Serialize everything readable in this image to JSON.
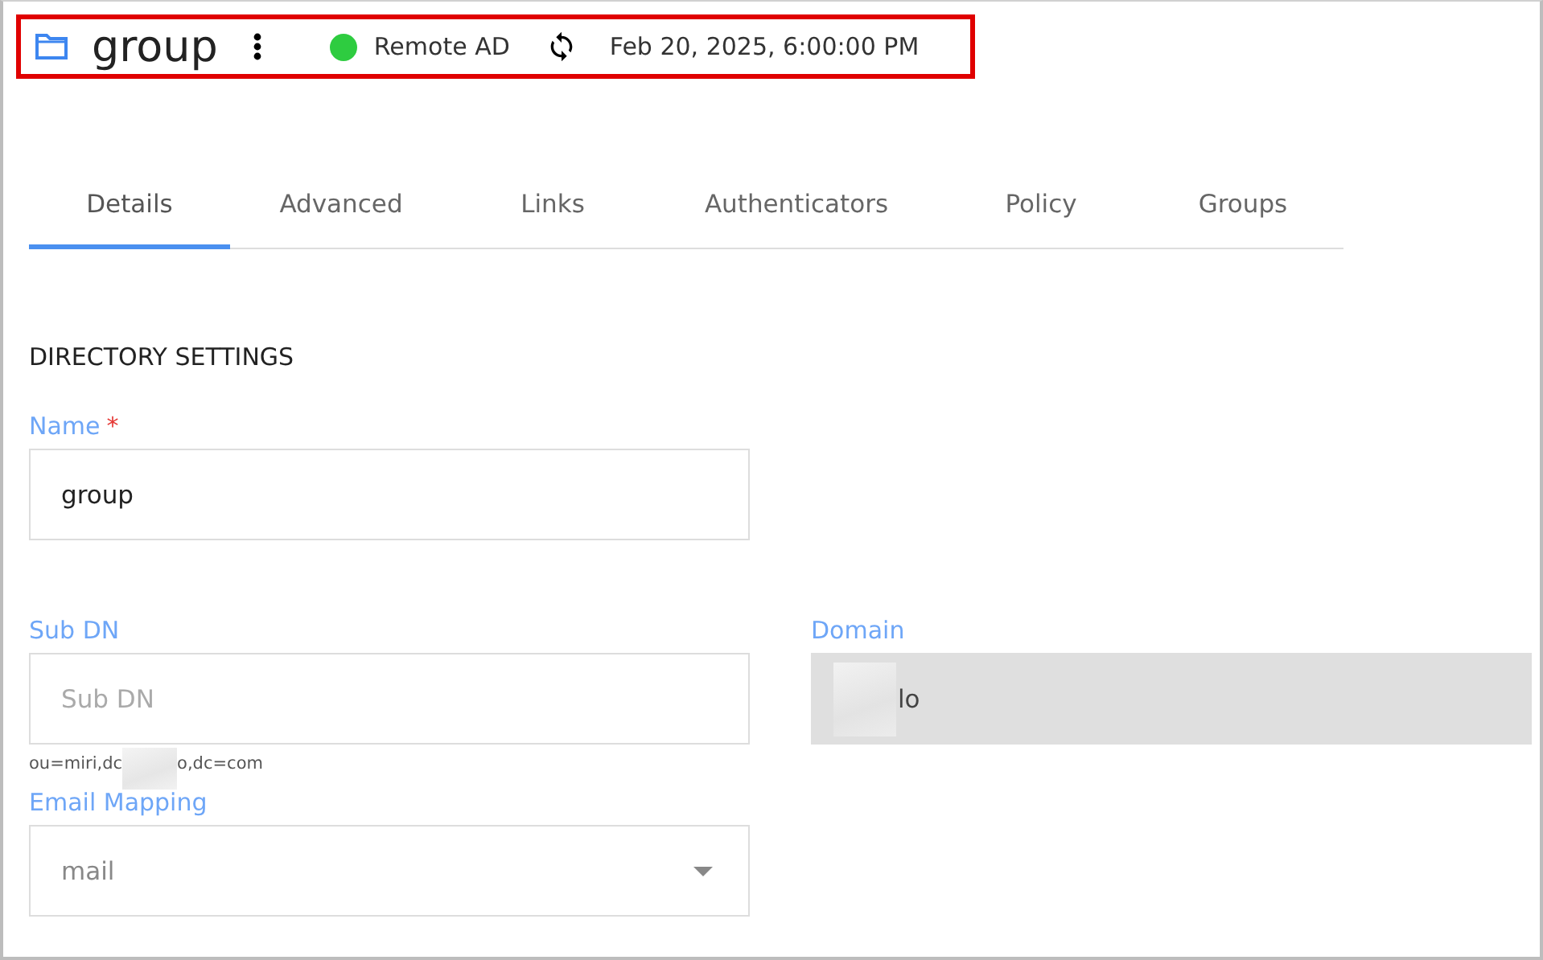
{
  "header": {
    "title": "group",
    "status": {
      "label": "Remote AD",
      "color": "#2ecc40"
    },
    "timestamp": "Feb 20, 2025, 6:00:00 PM"
  },
  "tabs": [
    {
      "label": "Details",
      "selected": true
    },
    {
      "label": "Advanced",
      "selected": false
    },
    {
      "label": "Links",
      "selected": false
    },
    {
      "label": "Authenticators",
      "selected": false
    },
    {
      "label": "Policy",
      "selected": false
    },
    {
      "label": "Groups",
      "selected": false
    }
  ],
  "section_title": "DIRECTORY SETTINGS",
  "fields": [
    {
      "kind": "text",
      "label": "Name",
      "required_mark": "*",
      "value": "group"
    },
    {
      "kind": "text",
      "label": "Sub DN",
      "placeholder": "Sub DN",
      "hint": [
        "ou=miri,dc",
        "o,dc=com"
      ]
    },
    {
      "kind": "readonly",
      "label": "Domain",
      "value": "lo"
    },
    {
      "kind": "select",
      "label": "Email Mapping",
      "value": "mail"
    }
  ]
}
